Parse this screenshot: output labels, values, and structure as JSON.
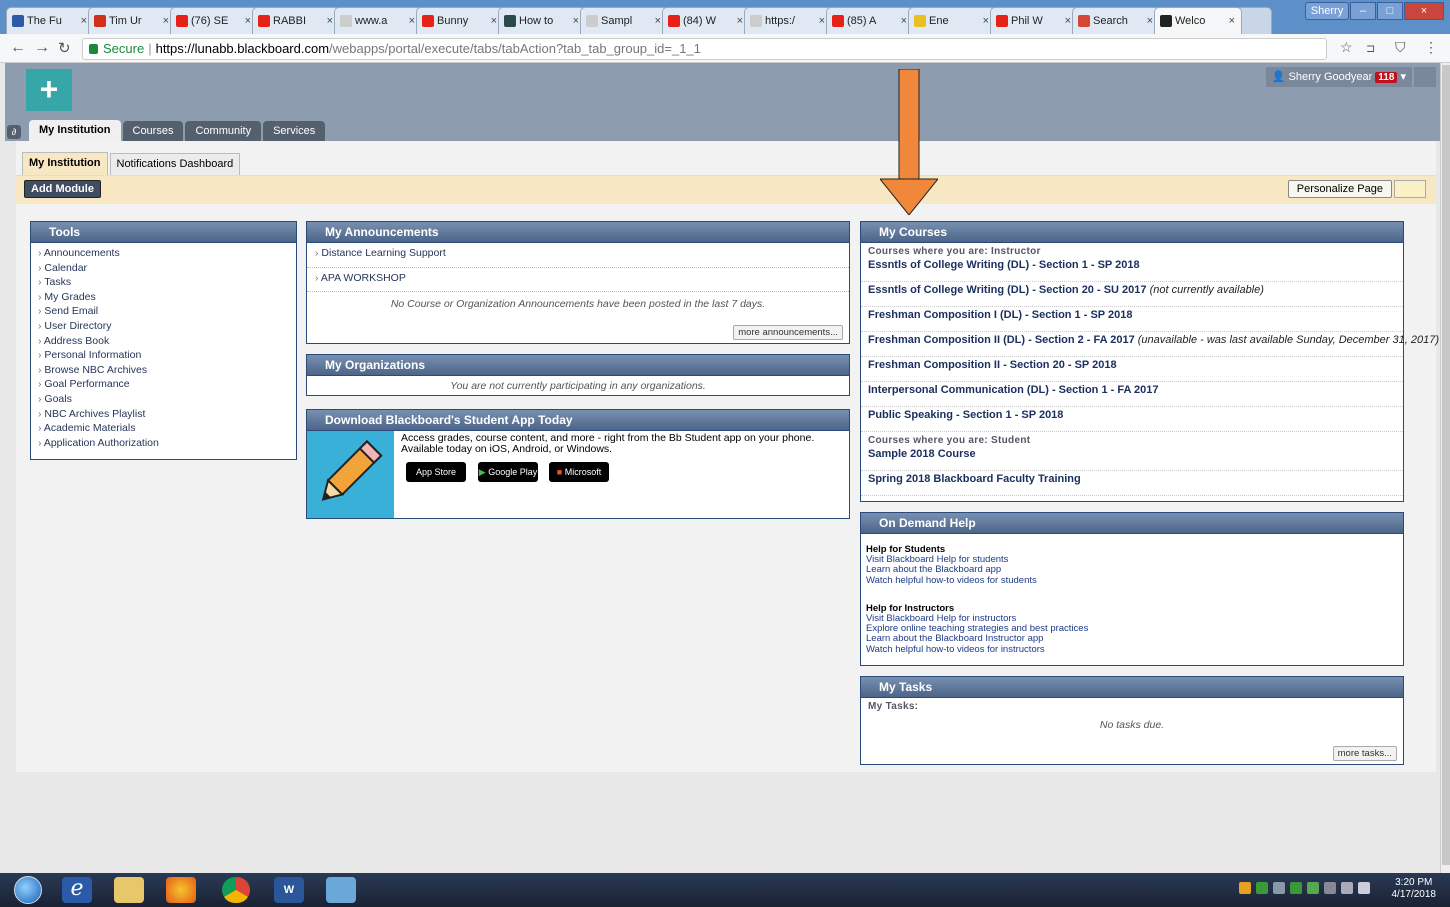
{
  "browser": {
    "tabs": [
      {
        "label": "The Fu",
        "color": "#2a5aa8"
      },
      {
        "label": "Tim Ur",
        "color": "#d0301a"
      },
      {
        "label": "(76) SE",
        "color": "#e62117"
      },
      {
        "label": "RABBI",
        "color": "#e62117"
      },
      {
        "label": "www.a",
        "color": "#cccccc"
      },
      {
        "label": "Bunny",
        "color": "#e62117"
      },
      {
        "label": "How to",
        "color": "#2b4a4a"
      },
      {
        "label": "Sampl",
        "color": "#cccccc"
      },
      {
        "label": "(84) W",
        "color": "#e62117"
      },
      {
        "label": "https:/",
        "color": "#cccccc"
      },
      {
        "label": "(85) A",
        "color": "#e62117"
      },
      {
        "label": "Ene",
        "color": "#e8c020"
      },
      {
        "label": "Phil W",
        "color": "#e62117"
      },
      {
        "label": "Search",
        "color": "#d44638"
      },
      {
        "label": "Welco",
        "color": "#222222"
      }
    ],
    "profile": "Sherry",
    "secure_label": "Secure",
    "url_host": "https://lunabb.blackboard.com",
    "url_path": "/webapps/portal/execute/tabs/tabAction?tab_tab_group_id=_1_1"
  },
  "header": {
    "user_name": "Sherry Goodyear",
    "notif_count": "118",
    "nav_tabs": [
      "My Institution",
      "Courses",
      "Community",
      "Services"
    ]
  },
  "page": {
    "subtabs": [
      "My Institution",
      "Notifications Dashboard"
    ],
    "add_module": "Add Module",
    "personalize": "Personalize Page"
  },
  "tools": {
    "title": "Tools",
    "items": [
      "Announcements",
      "Calendar",
      "Tasks",
      "My Grades",
      "Send Email",
      "User Directory",
      "Address Book",
      "Personal Information",
      "Browse NBC Archives",
      "Goal Performance",
      "Goals",
      "NBC Archives Playlist",
      "Academic Materials",
      "Application Authorization"
    ]
  },
  "announcements": {
    "title": "My Announcements",
    "items": [
      "Distance Learning Support",
      "APA WORKSHOP"
    ],
    "note": "No Course or Organization Announcements have been posted in the last 7 days.",
    "more": "more announcements..."
  },
  "organizations": {
    "title": "My Organizations",
    "note": "You are not currently participating in any organizations."
  },
  "app": {
    "title": "Download Blackboard's Student App Today",
    "line1": "Access grades, course content, and more - right from the Bb Student app on your phone.",
    "line2": "Available today on iOS, Android, or Windows.",
    "stores": [
      "App Store",
      "Google Play",
      "Microsoft"
    ]
  },
  "courses": {
    "title": "My Courses",
    "instructor_label": "Courses where you are: Instructor",
    "instructor": [
      {
        "name": "Essntls of College Writing (DL) - Section 1 - SP 2018",
        "note": ""
      },
      {
        "name": "Essntls of College Writing (DL) - Section 20 - SU 2017",
        "note": "(not currently available)"
      },
      {
        "name": "Freshman Composition I (DL) - Section 1 - SP 2018",
        "note": ""
      },
      {
        "name": "Freshman Composition II (DL) - Section 2 - FA 2017",
        "note": "(unavailable - was last available Sunday, December 31, 2017)"
      },
      {
        "name": "Freshman Composition II - Section 20 - SP 2018",
        "note": ""
      },
      {
        "name": "Interpersonal Communication (DL) - Section 1 - FA 2017",
        "note": ""
      },
      {
        "name": "Public Speaking - Section 1 - SP 2018",
        "note": ""
      }
    ],
    "student_label": "Courses where you are: Student",
    "student": [
      {
        "name": "Sample 2018 Course",
        "note": ""
      },
      {
        "name": "Spring 2018 Blackboard Faculty Training",
        "note": ""
      }
    ]
  },
  "help": {
    "title": "On Demand Help",
    "students_heading": "Help for Students",
    "students_links": [
      "Visit Blackboard Help for students",
      "Learn about the Blackboard app",
      "Watch helpful how-to videos for students"
    ],
    "instructors_heading": "Help for Instructors",
    "instructors_links": [
      "Visit Blackboard Help for instructors",
      "Explore online teaching strategies and best practices",
      "Learn about the Blackboard Instructor app",
      "Watch helpful how-to videos for instructors"
    ]
  },
  "tasks": {
    "title": "My Tasks",
    "label": "My Tasks:",
    "note": "No tasks due.",
    "more": "more tasks..."
  },
  "taskbar": {
    "time": "3:20 PM",
    "date": "4/17/2018",
    "accent": "#f0873a"
  }
}
